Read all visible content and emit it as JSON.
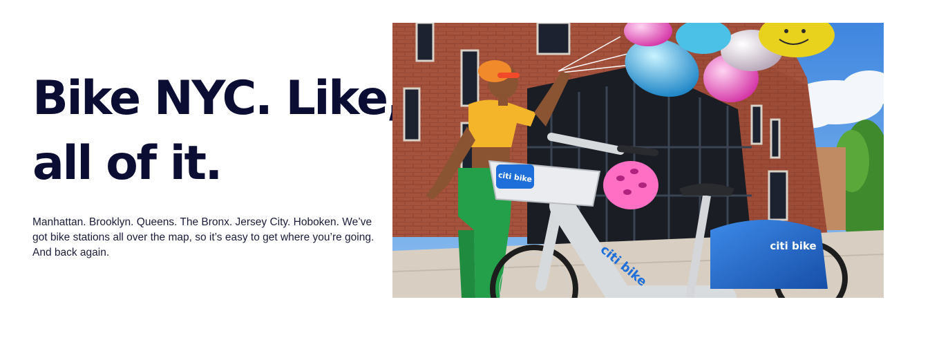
{
  "hero": {
    "title_line1": "Bike NYC. Like,",
    "title_line2": "all of it.",
    "description": "Manhattan. Brooklyn. Queens. The Bronx. Jersey City. Hoboken. We’ve got bike stations all over the map, so it’s easy to get where you’re going. And back again."
  },
  "photo": {
    "basket_logo": "citi bike",
    "frame_logo": "citi bike",
    "fender_logo": "citi bike"
  },
  "colors": {
    "heading": "#0b0d33",
    "brand_blue": "#1e6fd9",
    "brick": "#a6533d"
  }
}
